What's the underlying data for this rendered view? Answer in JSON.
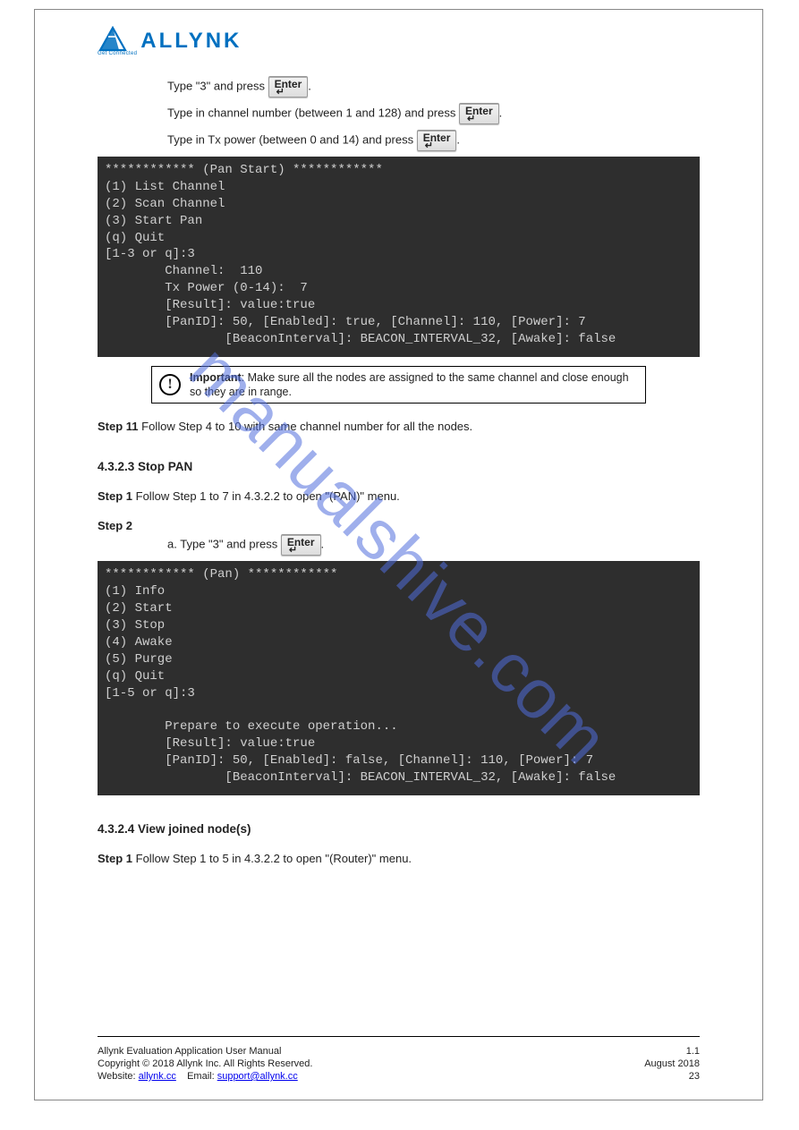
{
  "logo": {
    "text": "ALLYNK",
    "sub": "Get Connected"
  },
  "watermark": "manualshive.com",
  "steps": {
    "a1": "Type \"3\" and press",
    "a2": "Type in channel number (between 1 and 128) and press",
    "a3": "Type in Tx power (between 0 and 14) and press",
    "enterLabel": "Enter"
  },
  "terminal1": "************ (Pan Start) ************\n(1) List Channel\n(2) Scan Channel\n(3) Start Pan\n(q) Quit\n[1-3 or q]:3\n        Channel:  110\n        Tx Power (0-14):  7\n        [Result]: value:true\n        [PanID]: 50, [Enabled]: true, [Channel]: 110, [Power]: 7\n                [BeaconInterval]: BEACON_INTERVAL_32, [Awake]: false",
  "important": {
    "title": "Important",
    "text": "Make sure all the nodes are assigned to the same channel and close enough so they are in range."
  },
  "step11": {
    "label": "Step 11",
    "text": "Follow Step 4 to 10 with same channel number for all the nodes."
  },
  "stopPan": {
    "heading": "4.3.2.3 Stop PAN",
    "s1_label": "Step 1",
    "s1_text": "Follow Step 1 to 7 in 4.3.2.2 to open \"(PAN)\" menu.",
    "s2_label": "Step 2",
    "s2_a_label": "a.",
    "s2_a_text": "Type \"3\" and press"
  },
  "terminal2": "************ (Pan) ************\n(1) Info\n(2) Start\n(3) Stop\n(4) Awake\n(5) Purge\n(q) Quit\n[1-5 or q]:3\n\n        Prepare to execute operation...\n        [Result]: value:true\n        [PanID]: 50, [Enabled]: false, [Channel]: 110, [Power]: 7\n                [BeaconInterval]: BEACON_INTERVAL_32, [Awake]: false",
  "viewJoin": {
    "heading": "4.3.2.4 View joined node(s)",
    "s1_label": "Step 1",
    "s1_text": "Follow Step 1 to 5 in 4.3.2.2 to open \"(Router)\" menu."
  },
  "footer": {
    "left": "Allynk Evaluation Application User Manual",
    "right": "1.1",
    "date": "August 2018",
    "copyright": "Copyright © 2018 Allynk Inc. All Rights Reserved.",
    "website_label": "Website:",
    "website_url": "allynk.cc",
    "email_label": "Email:",
    "email": "support@allynk.cc",
    "page": "23"
  }
}
